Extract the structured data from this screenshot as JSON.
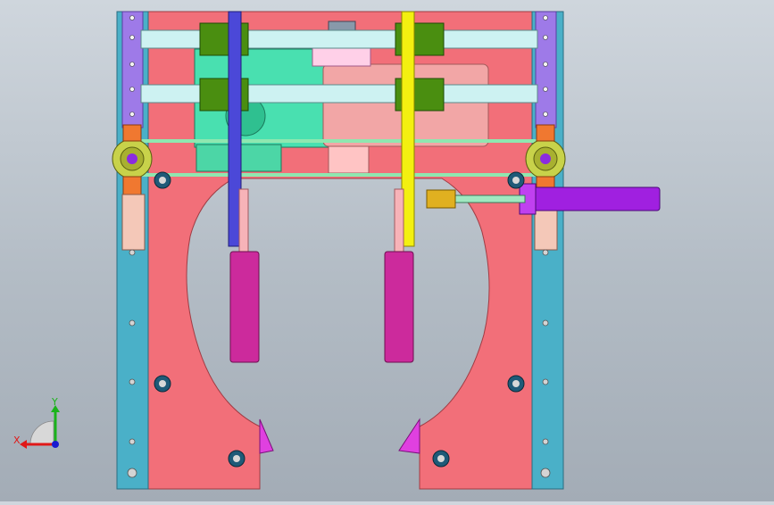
{
  "viewport": {
    "background_top": "#cfd6dd",
    "background_bottom": "#a3acb6"
  },
  "triad": {
    "x_label": "X",
    "y_label": "Y",
    "x_color": "#e01818",
    "y_color": "#1ab31a",
    "z_color": "#1a1ad0"
  },
  "colors": {
    "frame_red": "#f26f79",
    "side_rail": "#4ab0c8",
    "guide_rod": "#cdf2f2",
    "bushing": "#4a8e10",
    "blue_bar": "#4b48d8",
    "yellow_bar": "#f3f010",
    "cylinder_magenta": "#cc2a9c",
    "cylinder_purple": "#a020e0",
    "motor_pink": "#f2a6a6",
    "gearbox_teal": "#49e0b0",
    "pulley_olive": "#c8d24a",
    "bracket_orange": "#f07830",
    "chain_purple": "#9e7ae8",
    "jaw_magenta": "#e040e0",
    "fitting_gold": "#e0b020"
  },
  "icons": {
    "triad": "coordinate-triad-icon"
  }
}
